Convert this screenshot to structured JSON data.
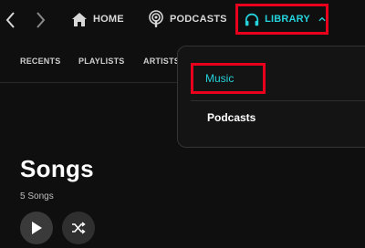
{
  "colors": {
    "accent": "#25d1da",
    "highlight_box": "#e8001d",
    "background": "#0f0f0f"
  },
  "topnav": {
    "back_icon": "chevron-left-icon",
    "forward_icon": "chevron-right-icon",
    "home": {
      "label": "HOME",
      "icon": "home-icon"
    },
    "podcasts": {
      "label": "PODCASTS",
      "icon": "podcast-icon"
    },
    "library": {
      "label": "LIBRARY",
      "icon": "headphones-icon",
      "chevron": "chevron-up-icon"
    }
  },
  "subnav": {
    "tabs": [
      "RECENTS",
      "PLAYLISTS",
      "ARTISTS"
    ]
  },
  "dropdown": {
    "items": [
      "Music",
      "Podcasts"
    ],
    "selected": "Music"
  },
  "main": {
    "title": "Songs",
    "song_count": "5 Songs",
    "play_icon": "play-icon",
    "shuffle_icon": "shuffle-icon"
  }
}
